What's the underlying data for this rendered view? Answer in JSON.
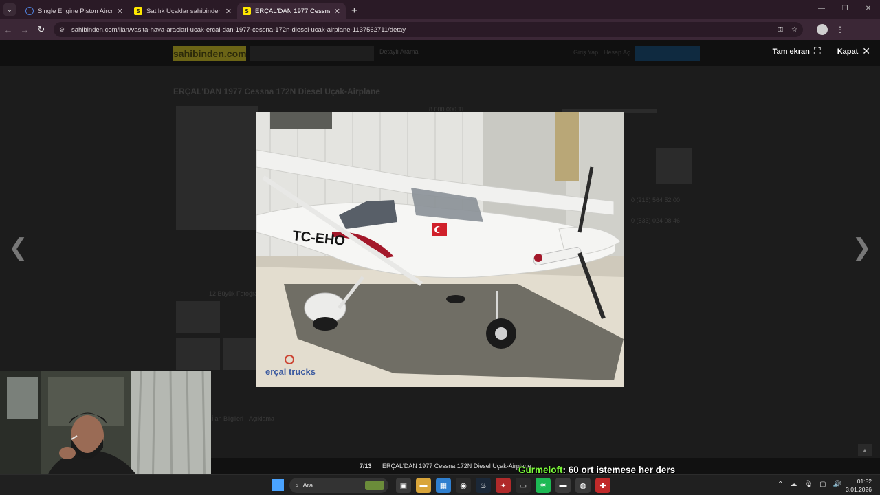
{
  "browser": {
    "tabs": [
      {
        "title": "Single Engine Piston Aircraft Fo",
        "favicon": "spinner-icon",
        "active": false
      },
      {
        "title": "Satılık Uçaklar sahibinden.com'",
        "favicon": "S",
        "active": false
      },
      {
        "title": "ERÇAL'DAN 1977 Cessna 172N",
        "favicon": "S",
        "active": true
      }
    ],
    "new_tab": "+",
    "url": "sahibinden.com/ilan/vasita-hava-araclari-ucak-ercal-dan-1977-cessna-172n-diesel-ucak-airplane-1137562711/detay"
  },
  "site": {
    "logo": "sahibinden.com",
    "detailed_search": "Detaylı Arama",
    "head_link_1": "Giriş Yap",
    "head_link_2": "Hesap Aç",
    "listing_title": "ERÇAL'DAN 1977 Cessna 172N Diesel Uçak-Airplane",
    "price": "8.000.000 TL",
    "phone_1": "0 (216) 564 52 00",
    "phone_2": "0 (533) 024 08 46",
    "photo_count_link": "12 Büyük Fotoğraf",
    "ghost_tab_1": "İlan Bilgileri",
    "ghost_tab_2": "Açıklama"
  },
  "lightbox": {
    "fullscreen_label": "Tam ekran",
    "close_label": "Kapat",
    "counter": "7/13",
    "caption": "ERÇAL'DAN 1977 Cessna 172N Diesel Uçak-Airplane",
    "photo": {
      "registration": "TC-EHO",
      "watermark": "erçal trucks"
    }
  },
  "stream_chat": {
    "user": "Gurmeloft",
    "message": ": 60 ort istemese her ders"
  },
  "taskbar": {
    "search_label": "Ara",
    "time": "01:52",
    "date": "3.01.2026"
  },
  "colors": {
    "tab_bar": "#2a1a26",
    "toolbar": "#3b2736",
    "chat_user": "#7cfc3a",
    "site_logo": "#ffe800"
  }
}
